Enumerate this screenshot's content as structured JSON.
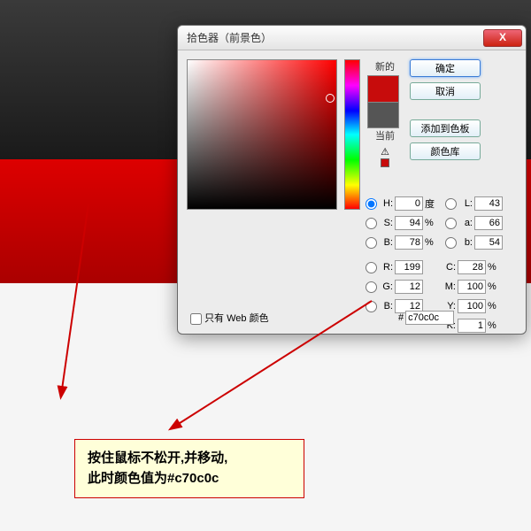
{
  "dialog": {
    "title": "拾色器（前景色）",
    "close": "X",
    "swatch": {
      "new_label": "新的",
      "current_label": "当前"
    },
    "buttons": {
      "ok": "确定",
      "cancel": "取消",
      "add": "添加到色板",
      "lib": "颜色库"
    },
    "hsv": {
      "h": "0",
      "h_unit": "度",
      "s": "94",
      "s_unit": "%",
      "b": "78",
      "b_unit": "%"
    },
    "rgb": {
      "r": "199",
      "g": "12",
      "b": "12"
    },
    "lab": {
      "l": "43",
      "a": "66",
      "b": "54"
    },
    "cmyk": {
      "c": "28",
      "m": "100",
      "y": "100",
      "k": "1",
      "unit": "%"
    },
    "web_only": "只有 Web 颜色",
    "hash": "#",
    "hex": "c70c0c"
  },
  "note": {
    "l1": "按住鼠标不松开,并移动,",
    "l2": "此时颜色值为#c70c0c"
  }
}
